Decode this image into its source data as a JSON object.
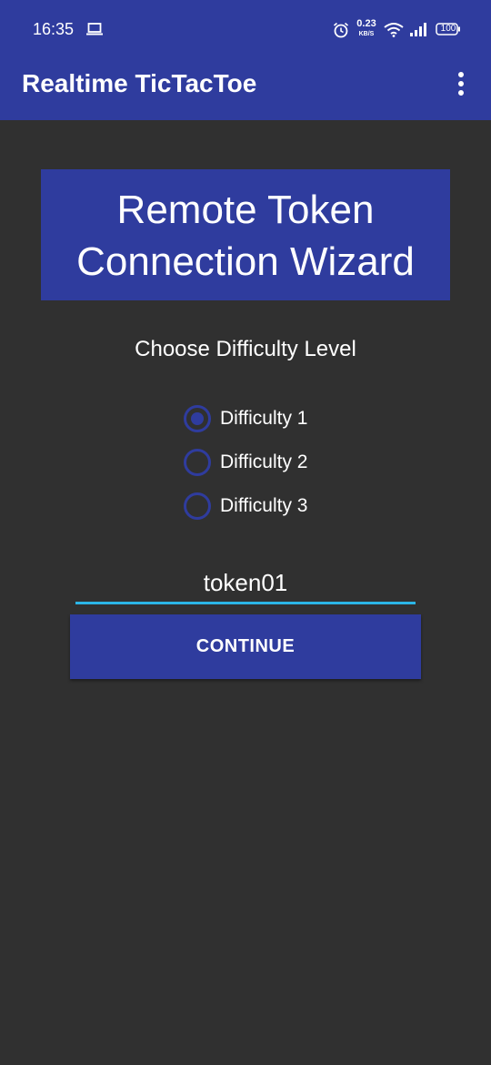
{
  "status_bar": {
    "time": "16:35",
    "net_speed_value": "0.23",
    "net_speed_unit": "KB/S",
    "battery": "100",
    "icons": [
      "laptop-icon",
      "alarm-icon",
      "wifi-icon",
      "signal-icon",
      "battery-icon"
    ]
  },
  "app_bar": {
    "title": "Realtime TicTacToe",
    "menu_icon": "overflow-menu-icon"
  },
  "wizard": {
    "title_line1": "Remote Token",
    "title_line2": "Connection Wizard",
    "prompt": "Choose Difficulty Level",
    "options": [
      {
        "label": "Difficulty 1",
        "selected": true
      },
      {
        "label": "Difficulty 2",
        "selected": false
      },
      {
        "label": "Difficulty 3",
        "selected": false
      }
    ],
    "token_value": "token01",
    "continue_label": "CONTINUE"
  },
  "colors": {
    "primary": "#2f3c9e",
    "background": "#303030",
    "accent": "#2bb5e6",
    "text": "#ffffff"
  }
}
